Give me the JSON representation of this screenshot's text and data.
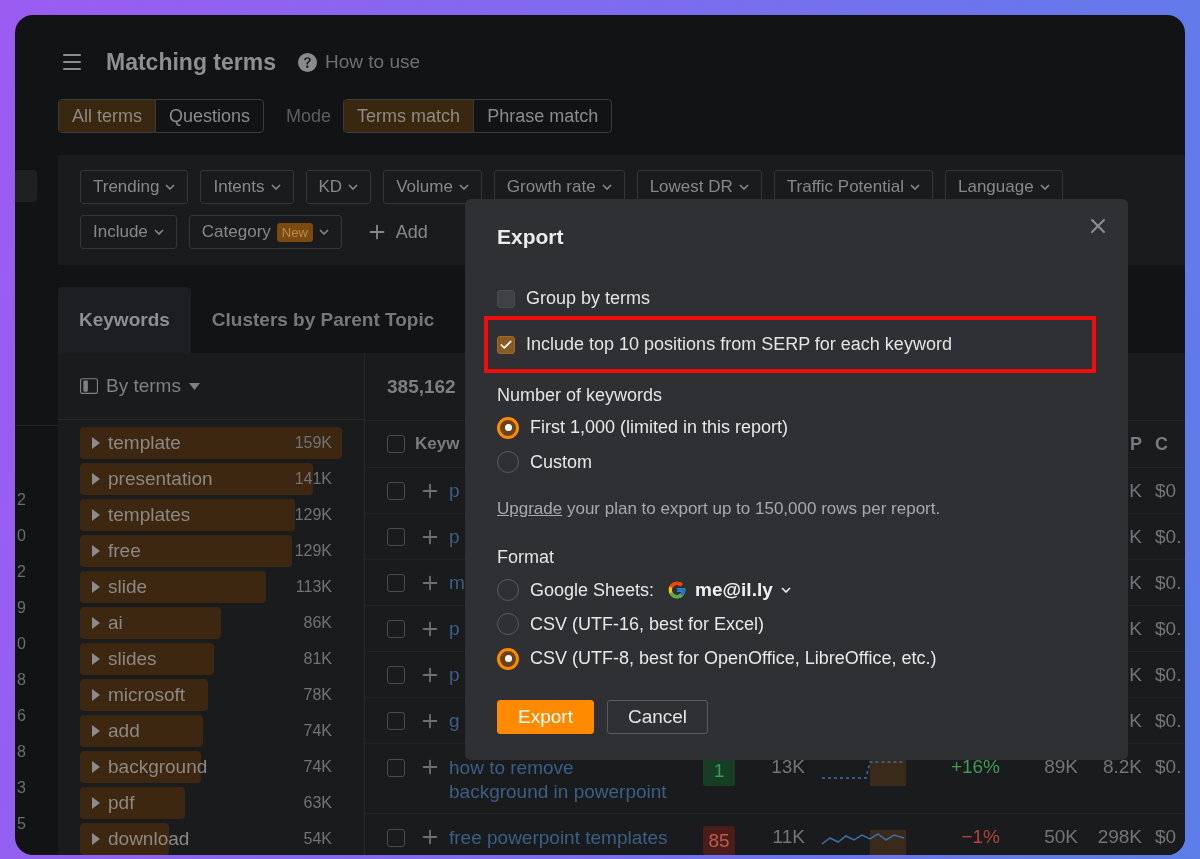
{
  "left_edge": {
    "values": [
      "2",
      "0",
      "2",
      "9",
      "0",
      "8",
      "6",
      "8",
      "3",
      "5"
    ]
  },
  "header": {
    "title": "Matching terms",
    "help": "How to use"
  },
  "view_tabs": [
    {
      "label": "All terms",
      "selected": true
    },
    {
      "label": "Questions",
      "selected": false
    }
  ],
  "mode": {
    "label": "Mode",
    "options": [
      {
        "label": "Terms match",
        "selected": true
      },
      {
        "label": "Phrase match",
        "selected": false
      }
    ]
  },
  "filters": {
    "rows": [
      [
        {
          "label": "Trending"
        },
        {
          "label": "Intents"
        },
        {
          "label": "KD"
        },
        {
          "label": "Volume"
        },
        {
          "label": "Growth rate"
        },
        {
          "label": "Lowest DR"
        },
        {
          "label": "Traffic Potential"
        },
        {
          "label": "Language"
        }
      ],
      [
        {
          "label": "Include"
        },
        {
          "label": "Category",
          "badge": "New"
        }
      ]
    ],
    "add": "Add"
  },
  "tabs": [
    {
      "label": "Keywords",
      "selected": true
    },
    {
      "label": "Clusters by Parent Topic",
      "selected": false
    }
  ],
  "terms_panel": {
    "grouping": "By terms",
    "items": [
      {
        "term": "template",
        "count": "159K",
        "level": 1.0
      },
      {
        "term": "presentation",
        "count": "141K",
        "level": 0.89
      },
      {
        "term": "templates",
        "count": "129K",
        "level": 0.82
      },
      {
        "term": "free",
        "count": "129K",
        "level": 0.81
      },
      {
        "term": "slide",
        "count": "113K",
        "level": 0.71
      },
      {
        "term": "ai",
        "count": "86K",
        "level": 0.54
      },
      {
        "term": "slides",
        "count": "81K",
        "level": 0.51
      },
      {
        "term": "microsoft",
        "count": "78K",
        "level": 0.49
      },
      {
        "term": "add",
        "count": "74K",
        "level": 0.47
      },
      {
        "term": "background",
        "count": "74K",
        "level": 0.46
      },
      {
        "term": "pdf",
        "count": "63K",
        "level": 0.4
      },
      {
        "term": "download",
        "count": "54K",
        "level": 0.34
      }
    ]
  },
  "table": {
    "total": "385,162",
    "select_all": {
      "checked": false
    },
    "columns": {
      "keyword": "Keyw",
      "tp": "P",
      "cpc": "C"
    },
    "rows": [
      {
        "kind": "partial",
        "checked": false,
        "keyword": "p",
        "tp": "K",
        "cpc": "$0"
      },
      {
        "kind": "partial",
        "checked": false,
        "keyword": "p",
        "tp": "K",
        "cpc": "$0."
      },
      {
        "kind": "partial",
        "checked": false,
        "keyword": "m",
        "tp": "K",
        "cpc": "$0."
      },
      {
        "kind": "partial",
        "checked": false,
        "keyword": "p",
        "tp": "K",
        "cpc": "$0."
      },
      {
        "kind": "partial",
        "checked": false,
        "keyword": "p",
        "tp": "K",
        "cpc": "$0."
      },
      {
        "kind": "partial",
        "checked": false,
        "keyword": "g",
        "tp": "K",
        "cpc": "$0."
      },
      {
        "kind": "full",
        "checked": false,
        "keyword": "how to remove background in powerpoint",
        "kd": {
          "value": "1",
          "color": "#173d24"
        },
        "volume": "13K",
        "growth": {
          "value": "+16%",
          "color": "#3e9a55"
        },
        "column_a": "89K",
        "tp": "8.2K",
        "cpc": "$0."
      },
      {
        "kind": "full",
        "checked": false,
        "keyword": "free powerpoint templates",
        "kd": {
          "value": "85",
          "color": "#4a1d1a"
        },
        "volume": "11K",
        "growth": {
          "value": "−1%",
          "color": "#b0443c"
        },
        "column_a": "50K",
        "tp": "298K",
        "cpc": "$0"
      }
    ]
  },
  "export_dialog": {
    "title": "Export",
    "options": [
      {
        "label": "Group by terms",
        "checked": false,
        "highlighted": false
      },
      {
        "label": "Include top 10 positions from SERP for each keyword",
        "checked": true,
        "highlighted": true
      }
    ],
    "count_label": "Number of keywords",
    "count_options": [
      {
        "label": "First 1,000 (limited in this report)",
        "selected": true
      },
      {
        "label": "Custom",
        "selected": false
      }
    ],
    "note_link": "Upgrade",
    "note": " your plan to export up to 150,000 rows per report.",
    "format_label": "Format",
    "format_options": [
      {
        "kind": "account",
        "label": "Google Sheets:",
        "account": "me@il.ly",
        "selected": false
      },
      {
        "kind": "plain",
        "label": "CSV (UTF-16, best for Excel)",
        "selected": false
      },
      {
        "kind": "plain",
        "label": "CSV (UTF-8, best for OpenOffice, LibreOffice, etc.)",
        "selected": true
      }
    ],
    "buttons": [
      {
        "label": "Export",
        "kind": "primary"
      },
      {
        "label": "Cancel",
        "kind": "secondary"
      }
    ]
  }
}
